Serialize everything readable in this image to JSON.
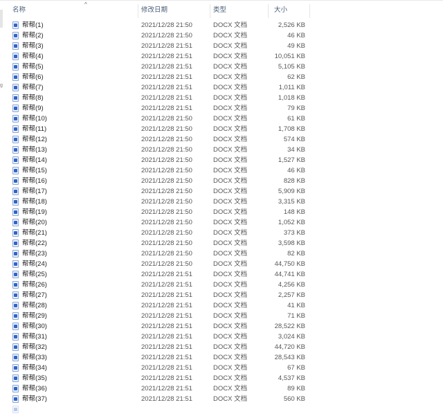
{
  "columns": {
    "name": "名称",
    "modified": "修改日期",
    "type": "类型",
    "size": "大小",
    "sort_indicator": "^"
  },
  "left_strip": {
    "mark": "g"
  },
  "files": [
    {
      "name": "帮帮(1)",
      "modified": "2021/12/28 21:50",
      "type": "DOCX 文档",
      "size": "2,526 KB"
    },
    {
      "name": "帮帮(2)",
      "modified": "2021/12/28 21:50",
      "type": "DOCX 文档",
      "size": "46 KB"
    },
    {
      "name": "帮帮(3)",
      "modified": "2021/12/28 21:51",
      "type": "DOCX 文档",
      "size": "49 KB"
    },
    {
      "name": "帮帮(4)",
      "modified": "2021/12/28 21:51",
      "type": "DOCX 文档",
      "size": "10,051 KB"
    },
    {
      "name": "帮帮(5)",
      "modified": "2021/12/28 21:51",
      "type": "DOCX 文档",
      "size": "5,105 KB"
    },
    {
      "name": "帮帮(6)",
      "modified": "2021/12/28 21:51",
      "type": "DOCX 文档",
      "size": "62 KB"
    },
    {
      "name": "帮帮(7)",
      "modified": "2021/12/28 21:51",
      "type": "DOCX 文档",
      "size": "1,011 KB"
    },
    {
      "name": "帮帮(8)",
      "modified": "2021/12/28 21:51",
      "type": "DOCX 文档",
      "size": "1,018 KB"
    },
    {
      "name": "帮帮(9)",
      "modified": "2021/12/28 21:51",
      "type": "DOCX 文档",
      "size": "79 KB"
    },
    {
      "name": "帮帮(10)",
      "modified": "2021/12/28 21:50",
      "type": "DOCX 文档",
      "size": "61 KB"
    },
    {
      "name": "帮帮(11)",
      "modified": "2021/12/28 21:50",
      "type": "DOCX 文档",
      "size": "1,708 KB"
    },
    {
      "name": "帮帮(12)",
      "modified": "2021/12/28 21:50",
      "type": "DOCX 文档",
      "size": "574 KB"
    },
    {
      "name": "帮帮(13)",
      "modified": "2021/12/28 21:50",
      "type": "DOCX 文档",
      "size": "34 KB"
    },
    {
      "name": "帮帮(14)",
      "modified": "2021/12/28 21:50",
      "type": "DOCX 文档",
      "size": "1,527 KB"
    },
    {
      "name": "帮帮(15)",
      "modified": "2021/12/28 21:50",
      "type": "DOCX 文档",
      "size": "46 KB"
    },
    {
      "name": "帮帮(16)",
      "modified": "2021/12/28 21:50",
      "type": "DOCX 文档",
      "size": "828 KB"
    },
    {
      "name": "帮帮(17)",
      "modified": "2021/12/28 21:50",
      "type": "DOCX 文档",
      "size": "5,909 KB"
    },
    {
      "name": "帮帮(18)",
      "modified": "2021/12/28 21:50",
      "type": "DOCX 文档",
      "size": "3,315 KB"
    },
    {
      "name": "帮帮(19)",
      "modified": "2021/12/28 21:50",
      "type": "DOCX 文档",
      "size": "148 KB"
    },
    {
      "name": "帮帮(20)",
      "modified": "2021/12/28 21:50",
      "type": "DOCX 文档",
      "size": "1,052 KB"
    },
    {
      "name": "帮帮(21)",
      "modified": "2021/12/28 21:50",
      "type": "DOCX 文档",
      "size": "373 KB"
    },
    {
      "name": "帮帮(22)",
      "modified": "2021/12/28 21:50",
      "type": "DOCX 文档",
      "size": "3,598 KB"
    },
    {
      "name": "帮帮(23)",
      "modified": "2021/12/28 21:50",
      "type": "DOCX 文档",
      "size": "82 KB"
    },
    {
      "name": "帮帮(24)",
      "modified": "2021/12/28 21:50",
      "type": "DOCX 文档",
      "size": "44,750 KB"
    },
    {
      "name": "帮帮(25)",
      "modified": "2021/12/28 21:51",
      "type": "DOCX 文档",
      "size": "44,741 KB"
    },
    {
      "name": "帮帮(26)",
      "modified": "2021/12/28 21:51",
      "type": "DOCX 文档",
      "size": "4,256 KB"
    },
    {
      "name": "帮帮(27)",
      "modified": "2021/12/28 21:51",
      "type": "DOCX 文档",
      "size": "2,257 KB"
    },
    {
      "name": "帮帮(28)",
      "modified": "2021/12/28 21:51",
      "type": "DOCX 文档",
      "size": "41 KB"
    },
    {
      "name": "帮帮(29)",
      "modified": "2021/12/28 21:51",
      "type": "DOCX 文档",
      "size": "71 KB"
    },
    {
      "name": "帮帮(30)",
      "modified": "2021/12/28 21:51",
      "type": "DOCX 文档",
      "size": "28,522 KB"
    },
    {
      "name": "帮帮(31)",
      "modified": "2021/12/28 21:51",
      "type": "DOCX 文档",
      "size": "3,024 KB"
    },
    {
      "name": "帮帮(32)",
      "modified": "2021/12/28 21:51",
      "type": "DOCX 文档",
      "size": "44,720 KB"
    },
    {
      "name": "帮帮(33)",
      "modified": "2021/12/28 21:51",
      "type": "DOCX 文档",
      "size": "28,543 KB"
    },
    {
      "name": "帮帮(34)",
      "modified": "2021/12/28 21:51",
      "type": "DOCX 文档",
      "size": "67 KB"
    },
    {
      "name": "帮帮(35)",
      "modified": "2021/12/28 21:51",
      "type": "DOCX 文档",
      "size": "4,537 KB"
    },
    {
      "name": "帮帮(36)",
      "modified": "2021/12/28 21:51",
      "type": "DOCX 文档",
      "size": "89 KB"
    },
    {
      "name": "帮帮(37)",
      "modified": "2021/12/28 21:51",
      "type": "DOCX 文档",
      "size": "560 KB"
    }
  ]
}
